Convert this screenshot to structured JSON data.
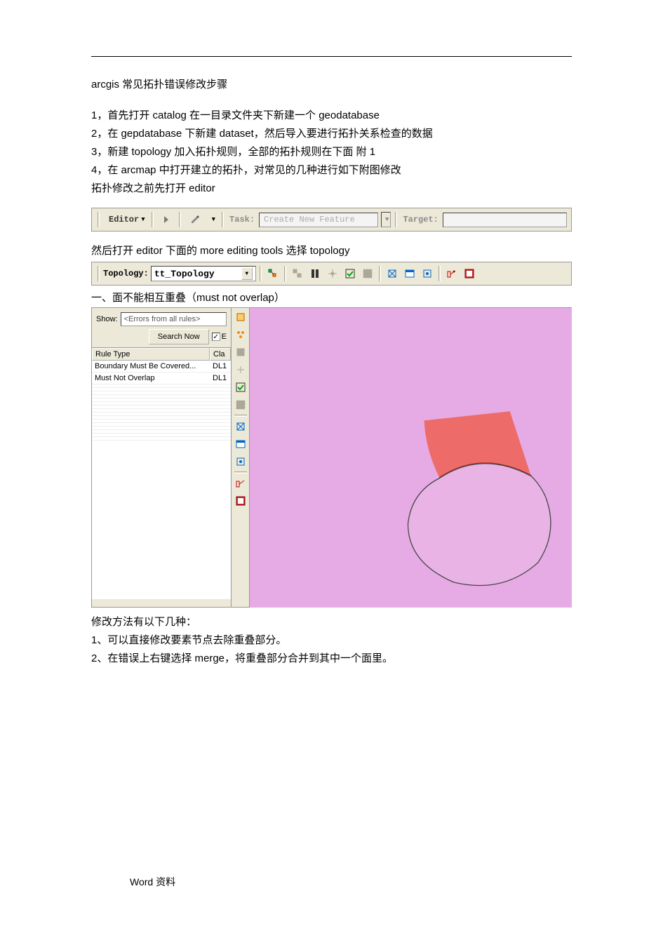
{
  "title": "arcgis 常见拓扑错误修改步骤",
  "steps": [
    "1，首先打开 catalog   在一目录文件夹下新建一个  geodatabase",
    "2，在 gepdatabase 下新建 dataset，然后导入要进行拓扑关系检查的数据",
    "3，新建 topology   加入拓扑规则，全部的拓扑规则在下面   附 1",
    "4，在 arcmap 中打开建立的拓扑，对常见的几种进行如下附图修改"
  ],
  "pre_editor_line": "拓扑修改之前先打开 editor",
  "editor_toolbar": {
    "editor_label": "Editor",
    "task_label": "Task:",
    "task_value": "Create New Feature",
    "target_label": "Target:"
  },
  "post_editor_line": "然后打开 editor 下面的 more  editing  tools   选择 topology",
  "topology_toolbar": {
    "label": "Topology:",
    "value": "tt_Topology"
  },
  "section_heading": "一、面不能相互重叠（must  not  overlap）",
  "error_panel": {
    "show_label": "Show:",
    "filter_value": "<Errors from all rules>",
    "search_btn": "Search Now",
    "errors_chk_label": "E",
    "col1": "Rule Type",
    "col2": "Cla",
    "rows": [
      {
        "rule": "Boundary Must Be Covered...",
        "cls": "DL1"
      },
      {
        "rule": "Must Not Overlap",
        "cls": "DL1"
      }
    ]
  },
  "fix_heading": "修改方法有以下几种：",
  "fixes": [
    "1、可以直接修改要素节点去除重叠部分。",
    "2、在错误上右键选择 merge，将重叠部分合并到其中一个面里。"
  ],
  "footer": "Word 资料"
}
